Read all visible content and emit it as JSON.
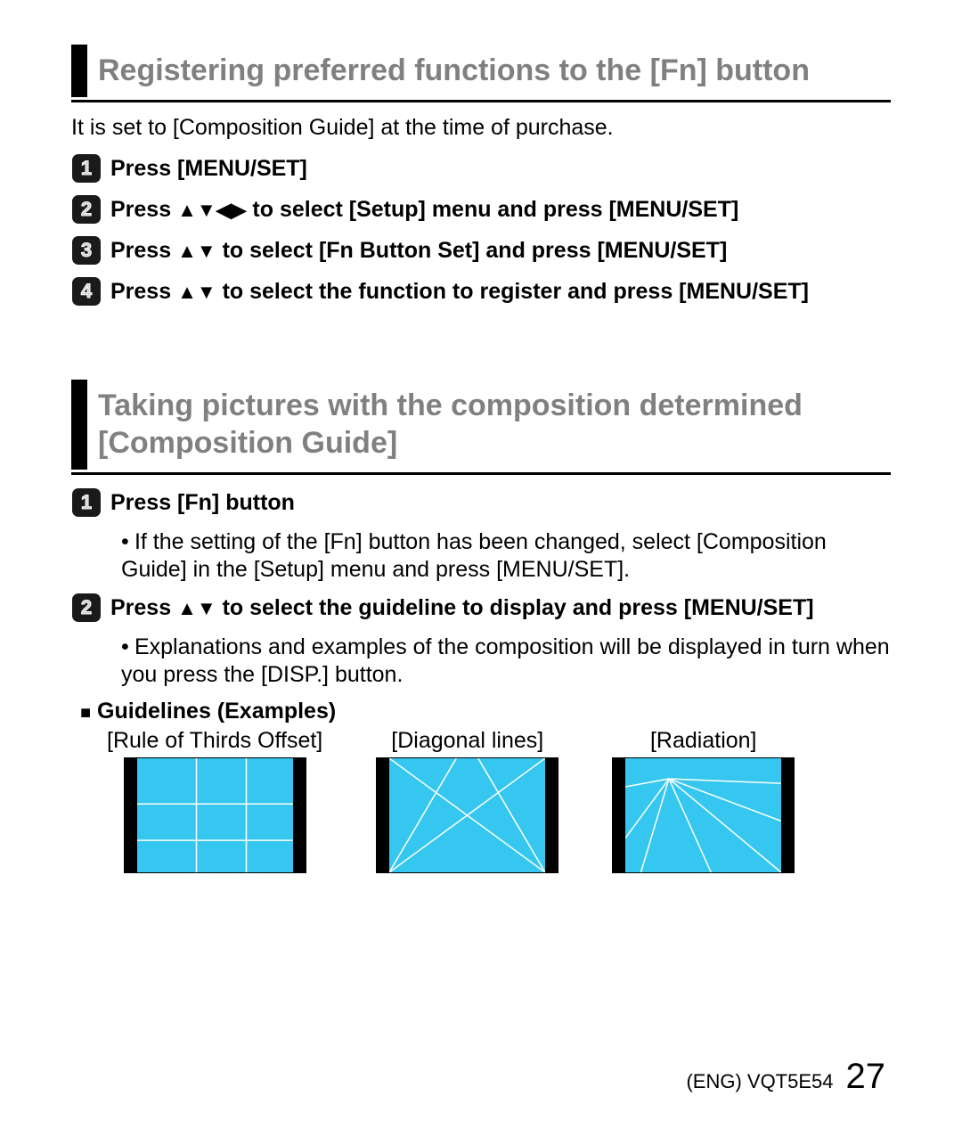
{
  "section1": {
    "title": "Registering preferred functions to the [Fn] button",
    "intro": "It is set to [Composition Guide] at the time of purchase.",
    "steps": [
      {
        "num": "1",
        "text_before": "Press [MENU/SET]",
        "arrows": "",
        "text_after": ""
      },
      {
        "num": "2",
        "text_before": "Press ",
        "arrows": "udlr",
        "text_after": " to select [Setup] menu and press [MENU/SET]"
      },
      {
        "num": "3",
        "text_before": "Press ",
        "arrows": "ud",
        "text_after": " to select [Fn Button Set] and press [MENU/SET]"
      },
      {
        "num": "4",
        "text_before": "Press ",
        "arrows": "ud",
        "text_after": " to select the function to register and press [MENU/SET]"
      }
    ]
  },
  "section2": {
    "title": "Taking pictures with the composition determined [Composition Guide]",
    "steps": [
      {
        "num": "1",
        "text_before": "Press [Fn] button",
        "arrows": "",
        "text_after": "",
        "bullet": "If the setting of the [Fn] button has been changed, select [Composition Guide] in the [Setup] menu and press [MENU/SET]."
      },
      {
        "num": "2",
        "text_before": "Press ",
        "arrows": "ud",
        "text_after": " to select the guideline to display and press [MENU/SET]",
        "bullet": "Explanations and examples of the composition will be displayed in turn when you press the [DISP.] button."
      }
    ],
    "guidelines_title": "Guidelines (Examples)",
    "examples": [
      {
        "label": "[Rule of Thirds Offset]",
        "type": "thirds"
      },
      {
        "label": "[Diagonal lines]",
        "type": "diagonal"
      },
      {
        "label": "[Radiation]",
        "type": "radiation"
      }
    ]
  },
  "footer": {
    "doc": "(ENG) VQT5E54",
    "page": "27"
  }
}
